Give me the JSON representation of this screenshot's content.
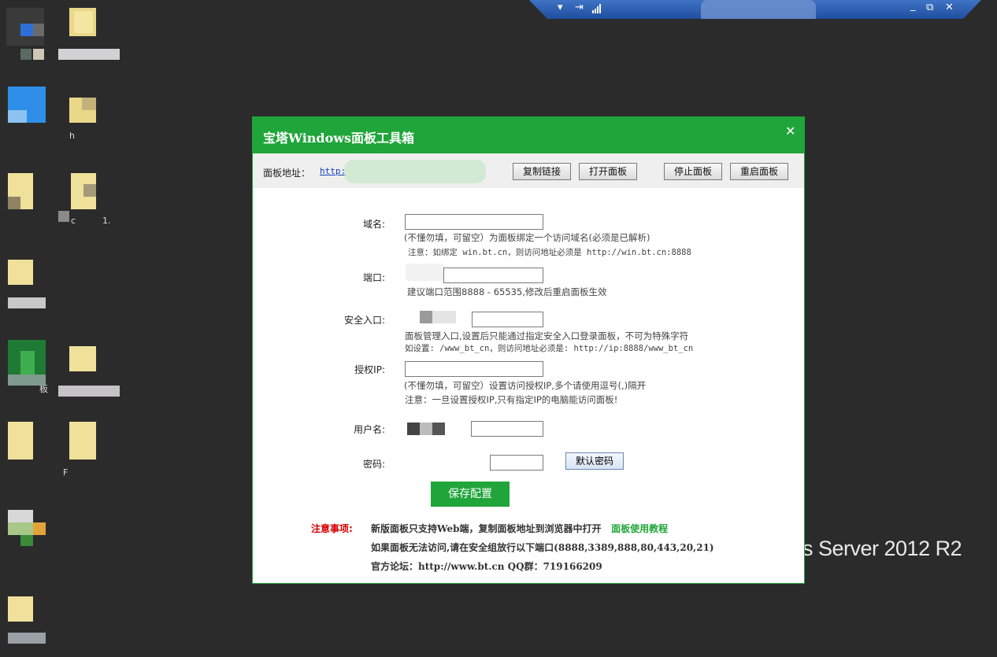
{
  "rdp": {
    "minimize": "_",
    "restore": "⧉",
    "close": "✕",
    "chevron": "▾",
    "pin": "⇥"
  },
  "wallpaper": {
    "text": "ws Server 2012 R2"
  },
  "desktop": {
    "labels": [
      "板",
      "c",
      "1.",
      "h",
      "F"
    ]
  },
  "dialog": {
    "title": "宝塔Windows面板工具箱",
    "close": "✕",
    "address": {
      "label": "面板地址：",
      "link": "http:"
    },
    "toolbar": {
      "copy": "复制链接",
      "open": "打开面板",
      "stop": "停止面板",
      "restart": "重启面板"
    },
    "fields": {
      "domain": {
        "label": "域名:",
        "value": "",
        "hint1": "(不懂勿填，可留空）为面板绑定一个访问域名(必须是已解析)",
        "hint2": "注意：如绑定 win.bt.cn，则访问地址必须是 http://win.bt.cn:8888"
      },
      "port": {
        "label": "端口:",
        "hint1": "建议端口范围8888 - 65535,修改后重启面板生效"
      },
      "security": {
        "label": "安全入口:",
        "hint1": "面板管理入口,设置后只能通过指定安全入口登录面板，不可为特殊字符",
        "hint2": "如设置: /www_bt_cn，则访问地址必须是: http://ip:8888/www_bt_cn"
      },
      "auth_ip": {
        "label": "授权IP:",
        "value": "",
        "hint1": "(不懂勿填，可留空）设置访问授权IP,多个请使用逗号(,)隔开",
        "hint2": "注意：一旦设置授权IP,只有指定IP的电脑能访问面板!"
      },
      "username": {
        "label": "用户名:"
      },
      "password": {
        "label": "密码:",
        "default_btn": "默认密码"
      }
    },
    "save": "保存配置",
    "notes": {
      "title": "注意事项:",
      "line1": "新版面板只支持Web端，复制面板地址到浏览器中打开",
      "tutorial": "面板使用教程",
      "line2": "如果面板无法访问,请在安全组放行以下端口(8888,3389,888,80,443,20,21)",
      "line3": "官方论坛：http://www.bt.cn  QQ群：719166209"
    }
  }
}
